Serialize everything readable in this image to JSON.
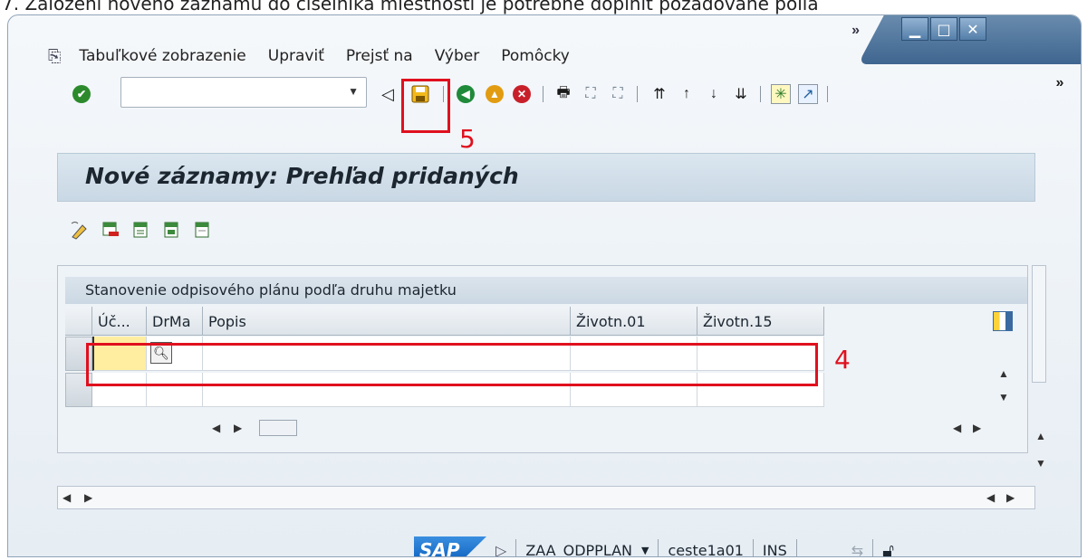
{
  "caption": "7. Založení nového záznamu do číselníka miestností je potrebné doplniť požadované polia",
  "window": {
    "controls": {
      "minimize": "▁",
      "maximize": "□",
      "close": "✕"
    },
    "more_top": "»"
  },
  "menu": {
    "items": [
      "Tabuľkové zobrazenie",
      "Upraviť",
      "Prejsť na",
      "Výber",
      "Pomôcky"
    ]
  },
  "toolbar": {
    "command_field_placeholder": "",
    "more": "»"
  },
  "annotations": {
    "save_marker": "5",
    "row_marker": "4"
  },
  "page": {
    "title": "Nové záznamy: Prehľad pridaných"
  },
  "table": {
    "caption": "Stanovenie odpisového plánu podľa druhu majetku",
    "columns": [
      "Úč...",
      "DrMa",
      "Popis",
      "Životn.01",
      "Životn.15"
    ]
  },
  "status": {
    "system": "SAP",
    "transaction": "ZAA_ODPPLAN",
    "server": "ceste1a01",
    "mode": "INS"
  },
  "colors": {
    "accent": "#0b5fbd",
    "highlight": "#e0101e",
    "input_required": "#ffeea0"
  }
}
